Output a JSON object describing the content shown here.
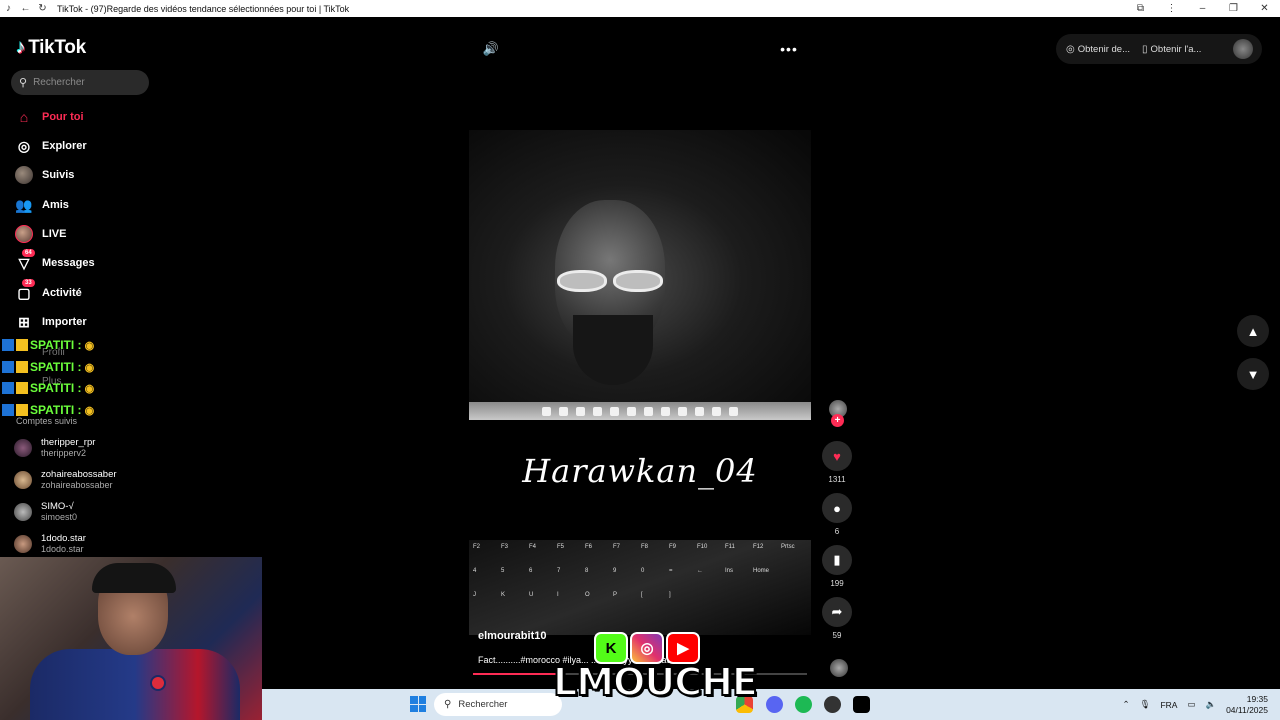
{
  "browser": {
    "title": "TikTok - (97)Regarde des vidéos tendance sélectionnées pour toi | TikTok"
  },
  "sidebar": {
    "logo": "TikTok",
    "search_placeholder": "Rechercher",
    "nav": [
      {
        "label": "Pour toi",
        "icon": "home-icon",
        "active": true
      },
      {
        "label": "Explorer",
        "icon": "compass-icon"
      },
      {
        "label": "Suivis",
        "icon": "avatar"
      },
      {
        "label": "Amis",
        "icon": "friends-icon"
      },
      {
        "label": "LIVE",
        "icon": "avatar"
      },
      {
        "label": "Messages",
        "icon": "inbox-icon",
        "badge": "64"
      },
      {
        "label": "Activité",
        "icon": "activity-icon",
        "badge": "33"
      },
      {
        "label": "Importer",
        "icon": "upload-icon"
      }
    ],
    "partial_labels": {
      "profil": "Profil",
      "plus": "Plus"
    },
    "followed_header": "Comptes suivis",
    "followed": [
      {
        "name": "theripper_rpr",
        "user": "theripperv2"
      },
      {
        "name": "zohaireabossaber",
        "user": "zohaireabossaber"
      },
      {
        "name": "SIMO-√",
        "user": "simoest0"
      },
      {
        "name": "1dodo.star",
        "user": "1dodo.star"
      }
    ]
  },
  "chat_overlay": {
    "rows": [
      "SPATITI :",
      "SPATITI :",
      "SPATITI :",
      "SPATITI :"
    ]
  },
  "video": {
    "overlay_text": "Harawkan_04",
    "author": "elmourabit10",
    "description": "Fact..........#morocco #ilya...                                         ...alo #tryy #motivation",
    "progress": 0.25,
    "keyboard_keys": [
      "F2",
      "F3",
      "F4",
      "F5",
      "F6",
      "F7",
      "F8",
      "F9",
      "F10",
      "F11",
      "F12",
      "Prtsc",
      "4",
      "5",
      "6",
      "7",
      "8",
      "9",
      "0",
      "=",
      "←",
      "Ins",
      "Home",
      "",
      "J",
      "K",
      "U",
      "I",
      "O",
      "P",
      "[",
      "]",
      "",
      "",
      "",
      ""
    ]
  },
  "actions": {
    "likes": "1311",
    "comments": "6",
    "saves": "199",
    "shares": "59"
  },
  "top_right": {
    "btn1": "Obtenir de...",
    "btn2": "Obtenir l'a..."
  },
  "streamer_overlay": {
    "name": "LMOUCHE",
    "icons": [
      "K",
      "IG",
      "YT"
    ]
  },
  "windows": {
    "search_placeholder": "Rechercher",
    "lang": "FRA",
    "time": "19:35",
    "date": "04/11/2025"
  },
  "colors": {
    "accent": "#fe2c55",
    "background": "#000000",
    "chat_green": "#6cff3c"
  }
}
